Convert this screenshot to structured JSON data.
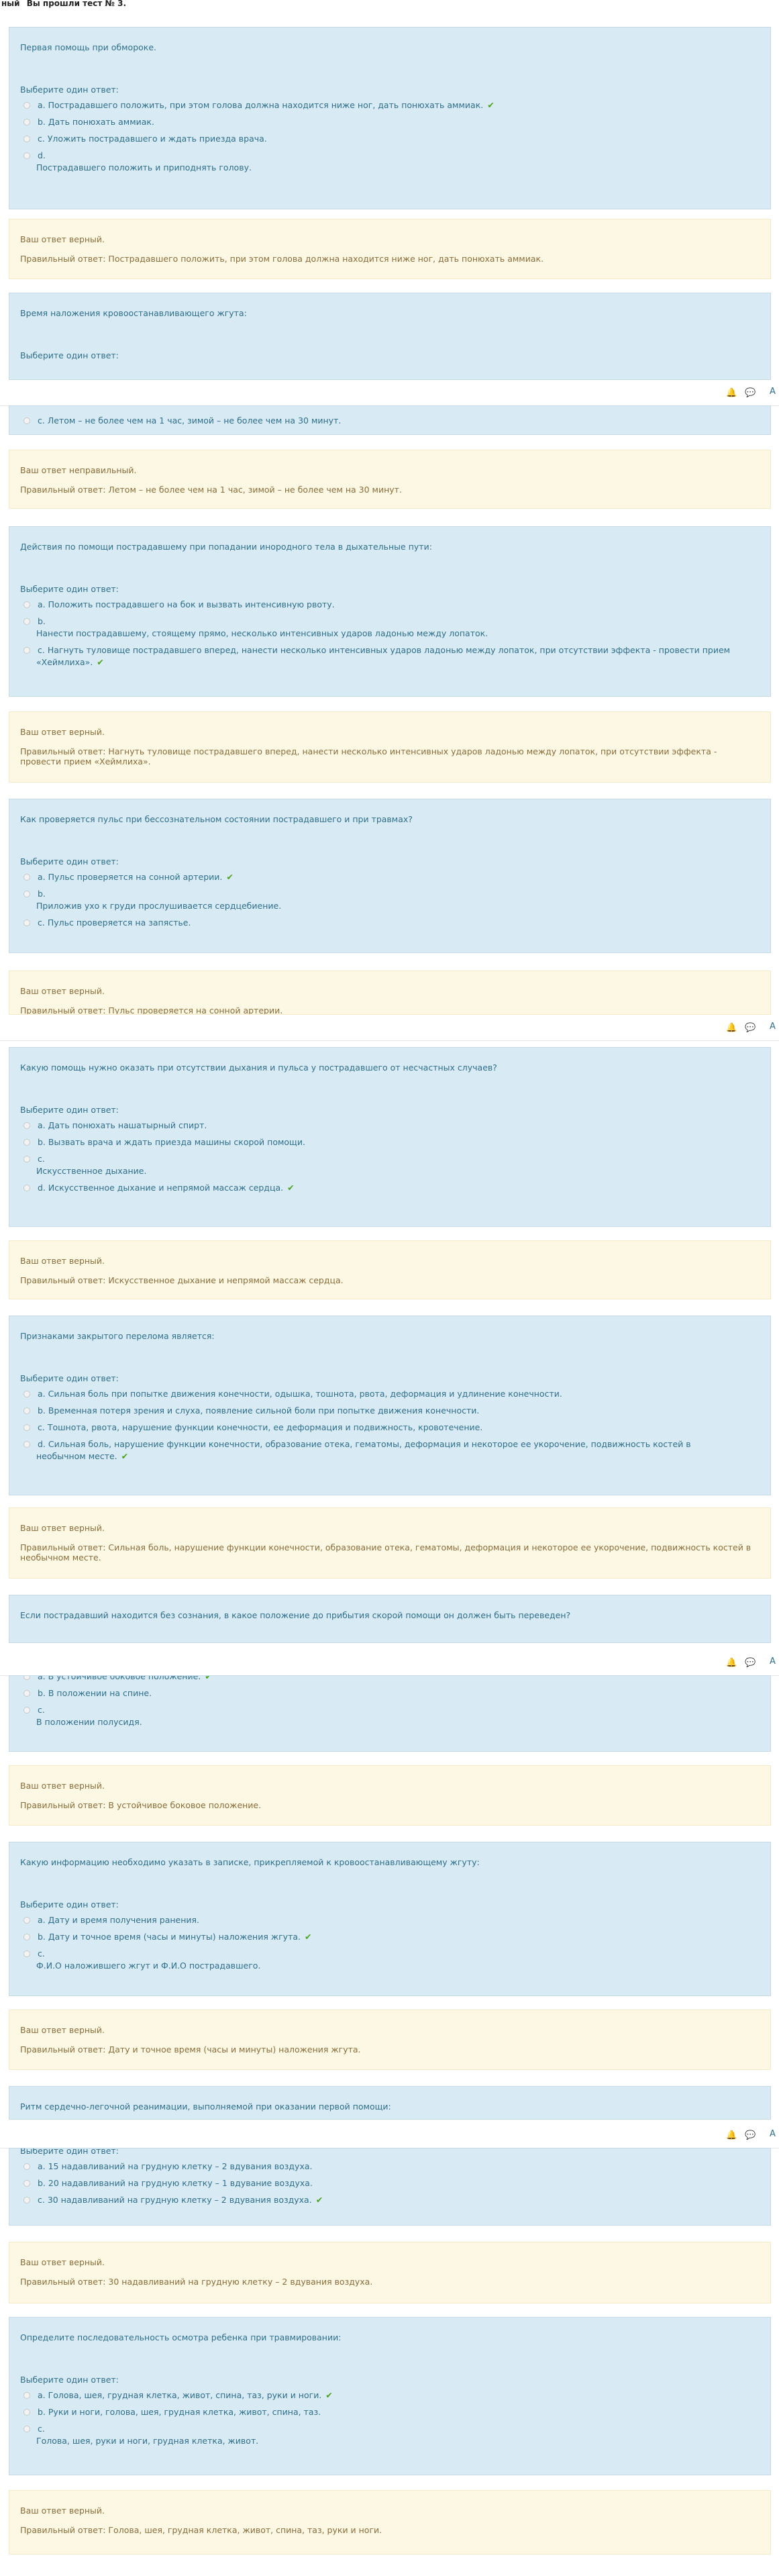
{
  "top": {
    "left": "ный",
    "right": "Вы прошли тест № 3."
  },
  "prompt": "Выберите один ответ:",
  "q1": {
    "text": "Первая помощь при обмороке.",
    "opts": [
      "a. Пострадавшего положить, при этом голова должна находится ниже ног, дать понюхать аммиак.",
      "b. Дать понюхать аммиак.",
      "c. Уложить пострадавшего и ждать приезда врача.",
      "d.",
      "Пострадавшего положить и приподнять голову."
    ],
    "fb1": "Ваш ответ верный.",
    "fb2": "Правильный ответ: Пострадавшего положить, при этом голова должна находится ниже ног, дать понюхать аммиак."
  },
  "q2": {
    "text": "Время наложения кровоостанавливающего жгута:",
    "opts": [
      "c. Летом – не более чем на 1 час, зимой – не более чем на 30 минут."
    ],
    "fb1": "Ваш ответ неправильный.",
    "fb2": "Правильный ответ: Летом – не более чем на 1 час, зимой – не более чем на 30 минут."
  },
  "q3": {
    "text": "Действия по помощи пострадавшему при попадании инородного тела в дыхательные пути:",
    "opts": [
      "a. Положить пострадавшего на бок и вызвать интенсивную рвоту.",
      "b.",
      "Нанести пострадавшему, стоящему прямо, несколько интенсивных ударов ладонью между лопаток.",
      "c. Нагнуть туловище пострадавшего вперед, нанести несколько интенсивных ударов ладонью между лопаток, при отсутствии эффекта - провести прием",
      "«Хеймлиха»."
    ],
    "fb1": "Ваш ответ верный.",
    "fb2": "Правильный ответ: Нагнуть туловище пострадавшего вперед, нанести несколько интенсивных ударов ладонью между лопаток, при отсутствии эффекта - провести прием «Хеймлиха»."
  },
  "q4": {
    "text": "Как проверяется пульс при бессознательном состоянии пострадавшего и при травмах?",
    "opts": [
      "a. Пульс проверяется на сонной артерии.",
      "b.",
      "Приложив ухо к груди прослушивается сердцебиение.",
      "c. Пульс проверяется на запястье."
    ],
    "fb1": "Ваш ответ верный.",
    "fb2": "Правильный ответ: Пульс проверяется на сонной артерии."
  },
  "q5": {
    "text": "Какую помощь нужно оказать при отсутствии дыхания и пульса у пострадавшего от несчастных случаев?",
    "opts": [
      "a. Дать понюхать нашатырный спирт.",
      "b. Вызвать врача и ждать приезда машины скорой помощи.",
      "c.",
      "Искусственное дыхание.",
      "d. Искусственное дыхание и непрямой массаж сердца."
    ],
    "fb1": "Ваш ответ верный.",
    "fb2": "Правильный ответ: Искусственное дыхание и непрямой массаж сердца."
  },
  "q6": {
    "text": "Признаками закрытого перелома является:",
    "opts": [
      "a. Сильная боль при попытке движения конечности, одышка, тошнота, рвота, деформация и удлинение конечности.",
      "b. Временная потеря зрения и слуха, появление сильной боли при попытке движения конечности.",
      "c. Тошнота, рвота, нарушение функции конечности, ее деформация и подвижность, кровотечение.",
      "d. Сильная боль, нарушение функции конечности, образование отека, гематомы, деформация и некоторое ее укорочение, подвижность костей в",
      "необычном месте."
    ],
    "fb1": "Ваш ответ верный.",
    "fb2": "Правильный ответ: Сильная боль, нарушение функции конечности, образование отека, гематомы, деформация и некоторое ее укорочение, подвижность костей в необычном месте."
  },
  "q7": {
    "text": "Если пострадавший находится без сознания, в какое положение до прибытия скорой помощи он должен быть переведен?",
    "opts": [
      "a. В устойчивое боковое положение.",
      "b. В положении на спине.",
      "c.",
      "В положении полусидя."
    ],
    "fb1": "Ваш ответ верный.",
    "fb2": "Правильный ответ: В устойчивое боковое положение."
  },
  "q8": {
    "text": "Какую информацию необходимо указать в записке, прикрепляемой к кровоостанавливающему жгуту:",
    "opts": [
      "a. Дату и время получения ранения.",
      "b. Дату и точное время (часы и минуты) наложения жгута.",
      "c.",
      "Ф.И.О наложившего жгут и Ф.И.О пострадавшего."
    ],
    "fb1": "Ваш ответ верный.",
    "fb2": "Правильный ответ: Дату и точное время (часы и минуты) наложения жгута."
  },
  "q9": {
    "text": "Ритм сердечно-легочной реанимации, выполняемой при оказании первой помощи:",
    "opts": [
      "a. 15 надавливаний на грудную клетку – 2 вдувания воздуха.",
      "b. 20 надавливаний на грудную клетку – 1 вдувание воздуха.",
      "c. 30 надавливаний на грудную клетку – 2 вдувания воздуха."
    ],
    "fb1": "Ваш ответ верный.",
    "fb2": "Правильный ответ: 30 надавливаний на грудную клетку – 2 вдувания воздуха."
  },
  "q10": {
    "text": "Определите последовательность осмотра ребенка при травмировании:",
    "opts": [
      "a. Голова, шея, грудная клетка, живот, спина, таз, руки и ноги.",
      "b. Руки и ноги, голова, шея, грудная клетка, живот, спина, таз.",
      "c.",
      "Голова, шея, руки и ноги, грудная клетка, живот."
    ],
    "fb1": "Ваш ответ верный.",
    "fb2": "Правильный ответ: Голова, шея, грудная клетка, живот, спина, таз, руки и ноги."
  },
  "navbar": {
    "initial": "А"
  },
  "colors": {
    "question_bg": "#d8eaf3",
    "feedback_bg": "#fcf8e3",
    "check": "#4aa31c"
  }
}
